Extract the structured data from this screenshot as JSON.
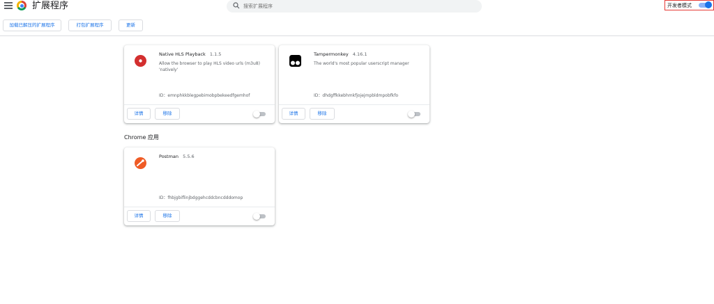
{
  "header": {
    "title": "扩展程序",
    "search_placeholder": "搜索扩展程序",
    "dev_mode_label": "开发者模式",
    "dev_mode_enabled": true
  },
  "toolbar": {
    "load_unpacked": "加载已解压的扩展程序",
    "pack_extension": "打包扩展程序",
    "update": "更新"
  },
  "extensions": [
    {
      "name": "Native HLS Playback",
      "version": "1.1.5",
      "description": "Allow the browser to play HLS video urls (m3u8) 'natively'",
      "id": "ID：emnphkkblegpebimobpbekeedfgemhof",
      "details_label": "详情",
      "remove_label": "移除",
      "enabled": false,
      "icon": "hls-play-icon"
    },
    {
      "name": "Tampermonkey",
      "version": "4.16.1",
      "description": "The world's most popular userscript manager",
      "id": "ID：dhdgffkkebhmkfjojejmpbldmpobfkfo",
      "details_label": "详情",
      "remove_label": "移除",
      "enabled": false,
      "icon": "tampermonkey-icon"
    }
  ],
  "apps_section": {
    "title": "Chrome 应用",
    "apps": [
      {
        "name": "Postman",
        "version": "5.5.6",
        "description": "",
        "id": "ID：fhbjgbiflinjbdggehcddcbncdddomop",
        "details_label": "详情",
        "remove_label": "移除",
        "enabled": false,
        "icon": "postman-icon"
      }
    ]
  },
  "colors": {
    "accent": "#1a73e8",
    "highlight_border": "#e53935",
    "hls_red": "#d32f2f",
    "postman_orange": "#ef5b25"
  }
}
